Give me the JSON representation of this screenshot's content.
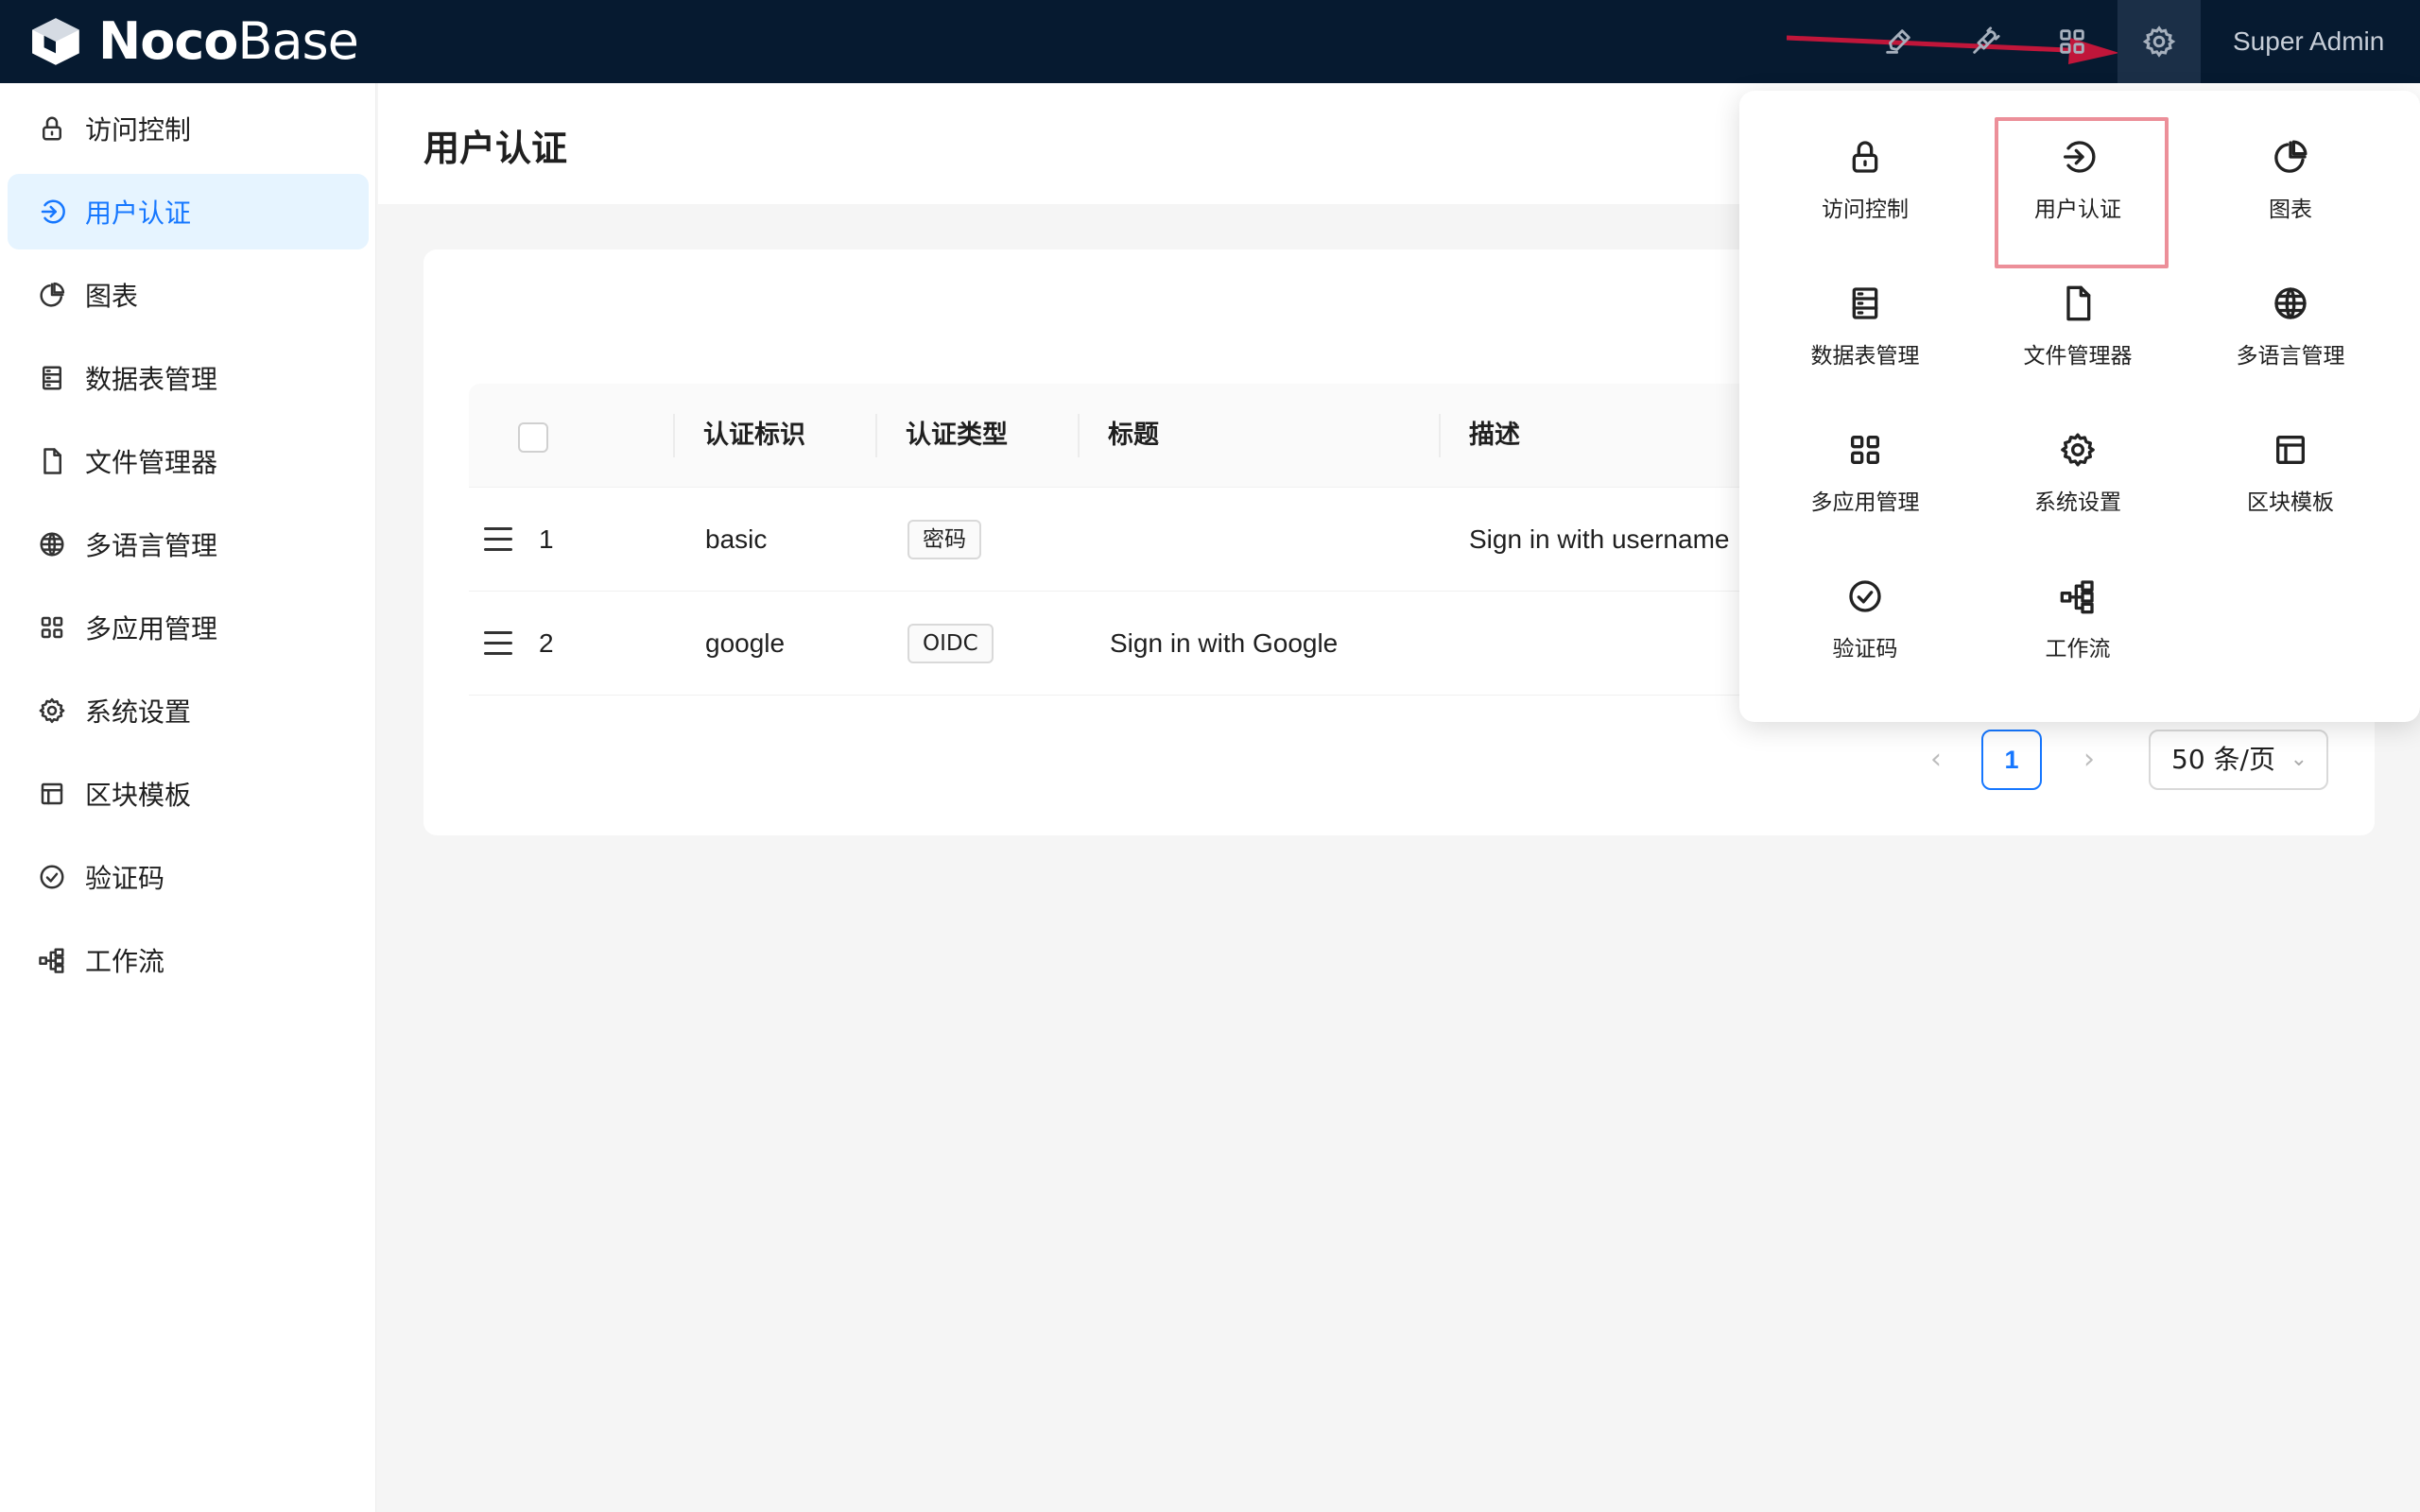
{
  "app": {
    "logo_bold": "Noco",
    "logo_light": "Base",
    "user_name": "Super Admin",
    "accent_color": "#1677ff",
    "topbar_color": "#061a30"
  },
  "topbar_icons": [
    "highlighter-icon",
    "plugin-icon",
    "apps-grid-icon",
    "gear-icon"
  ],
  "sidebar": {
    "items": [
      {
        "label": "访问控制",
        "icon": "lock-icon"
      },
      {
        "label": "用户认证",
        "icon": "login-icon",
        "active": true
      },
      {
        "label": "图表",
        "icon": "pie-chart-icon"
      },
      {
        "label": "数据表管理",
        "icon": "database-icon"
      },
      {
        "label": "文件管理器",
        "icon": "file-icon"
      },
      {
        "label": "多语言管理",
        "icon": "globe-icon"
      },
      {
        "label": "多应用管理",
        "icon": "apps-grid-icon"
      },
      {
        "label": "系统设置",
        "icon": "gear-icon"
      },
      {
        "label": "区块模板",
        "icon": "layout-icon"
      },
      {
        "label": "验证码",
        "icon": "check-circle-icon"
      },
      {
        "label": "工作流",
        "icon": "workflow-icon"
      }
    ]
  },
  "page": {
    "title": "用户认证"
  },
  "table": {
    "columns": [
      "认证标识",
      "认证类型",
      "标题",
      "描述"
    ],
    "rows": [
      {
        "index": "1",
        "name": "basic",
        "type": "密码",
        "title": "",
        "description": "Sign in with username"
      },
      {
        "index": "2",
        "name": "google",
        "type": "OIDC",
        "title": "Sign in with Google",
        "description": ""
      }
    ]
  },
  "pagination": {
    "current_page": "1",
    "page_size": "50 条/页",
    "prev": "‹",
    "next": "›",
    "chevron": "⌄"
  },
  "settings_panel": {
    "items": [
      {
        "label": "访问控制",
        "icon": "lock-icon"
      },
      {
        "label": "用户认证",
        "icon": "login-icon",
        "highlighted": true
      },
      {
        "label": "图表",
        "icon": "pie-chart-icon"
      },
      {
        "label": "数据表管理",
        "icon": "database-icon"
      },
      {
        "label": "文件管理器",
        "icon": "file-icon"
      },
      {
        "label": "多语言管理",
        "icon": "globe-icon"
      },
      {
        "label": "多应用管理",
        "icon": "apps-grid-icon"
      },
      {
        "label": "系统设置",
        "icon": "gear-icon"
      },
      {
        "label": "区块模板",
        "icon": "layout-icon"
      },
      {
        "label": "验证码",
        "icon": "check-circle-icon"
      },
      {
        "label": "工作流",
        "icon": "workflow-icon"
      }
    ],
    "highlight_color": "#ec8f99",
    "annotation_arrow_color": "#c0163a"
  }
}
